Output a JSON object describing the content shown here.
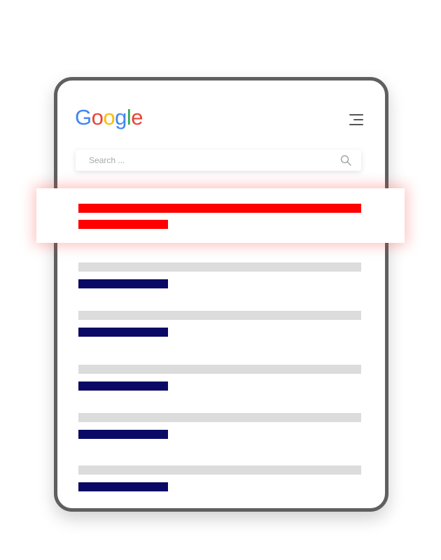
{
  "logo": {
    "letters": [
      "G",
      "o",
      "o",
      "g",
      "l",
      "e"
    ],
    "colors": [
      "#4285F4",
      "#EA4335",
      "#FBBC05",
      "#4285F4",
      "#34A853",
      "#EA4335"
    ]
  },
  "search": {
    "placeholder": "Search ..."
  },
  "menu": {
    "icon": "hamburger-menu-icon"
  },
  "colors": {
    "device_frame": "#5f5f5f",
    "highlight_result": "#ff0000",
    "snippet_placeholder": "#dcdcdc",
    "link_placeholder": "#0a0a66"
  },
  "results": [
    {
      "type": "highlighted"
    },
    {
      "type": "organic"
    },
    {
      "type": "organic"
    },
    {
      "type": "organic"
    },
    {
      "type": "organic"
    },
    {
      "type": "organic"
    }
  ]
}
